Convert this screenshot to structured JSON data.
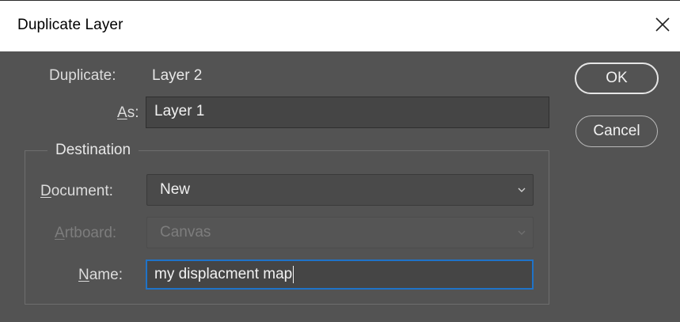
{
  "window": {
    "title": "Duplicate Layer",
    "close_icon": "close-icon"
  },
  "form": {
    "duplicate_label": "Duplicate:",
    "duplicate_value": "Layer 2",
    "as_label_ul": "A",
    "as_label_rest": "s:",
    "as_value": "Layer 1"
  },
  "destination": {
    "legend": "Destination",
    "document_label_ul": "D",
    "document_label_rest": "ocument:",
    "document_value": "New",
    "artboard_label_ul": "A",
    "artboard_label_rest": "rtboard:",
    "artboard_value": "Canvas",
    "artboard_disabled": true,
    "name_label_ul": "N",
    "name_label_rest": "ame:",
    "name_value": "my displacment map"
  },
  "buttons": {
    "ok_label": "OK",
    "cancel_label": "Cancel"
  },
  "colors": {
    "dialog_bg": "#535353",
    "focus_accent": "#1f73c8",
    "disabled_text": "#7d7d7d"
  }
}
